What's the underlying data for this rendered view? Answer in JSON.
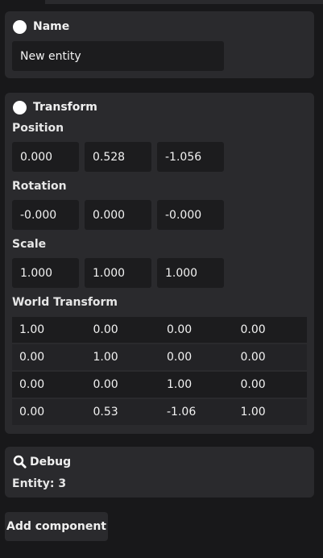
{
  "name_component": {
    "title": "Name",
    "value": "New entity"
  },
  "transform": {
    "title": "Transform",
    "position_label": "Position",
    "position": [
      "0.000",
      "0.528",
      "-1.056"
    ],
    "rotation_label": "Rotation",
    "rotation": [
      "-0.000",
      "0.000",
      "-0.000"
    ],
    "scale_label": "Scale",
    "scale": [
      "1.000",
      "1.000",
      "1.000"
    ],
    "world_label": "World Transform",
    "world": [
      [
        "1.00",
        "0.00",
        "0.00",
        "0.00"
      ],
      [
        "0.00",
        "1.00",
        "0.00",
        "0.00"
      ],
      [
        "0.00",
        "0.00",
        "1.00",
        "0.00"
      ],
      [
        "0.00",
        "0.53",
        "-1.06",
        "1.00"
      ]
    ]
  },
  "debug": {
    "title": "Debug",
    "entity_text": "Entity: 3",
    "icon": "search-icon"
  },
  "add_component_label": "Add component",
  "colors": {
    "background": "#18181a",
    "panel": "#2a2a2d",
    "field": "#1c1c1e",
    "text": "#ececec"
  }
}
